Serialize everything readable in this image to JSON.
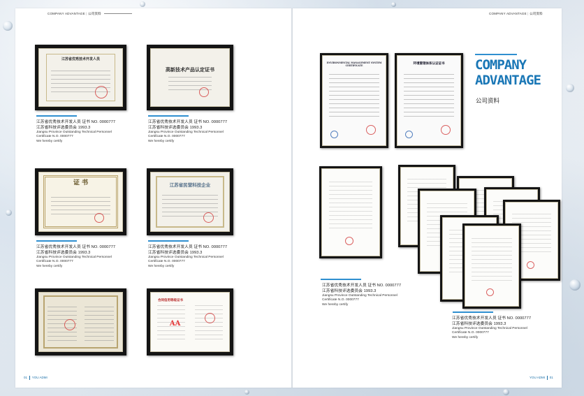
{
  "header": {
    "left_brand": "COMPANY ADVANTAGE",
    "left_section": "公司资料",
    "right_brand": "COMPANY ADVANTAGE",
    "right_section": "公司资料"
  },
  "footer": {
    "left_page": "01",
    "left_brand": "YOU ADMI",
    "right_brand": "YOU ADMI",
    "right_page": "01"
  },
  "title": {
    "line1": "COMPANY",
    "line2": "ADVANTAGE",
    "subtitle": "公司资料"
  },
  "certificates": {
    "c1_title": "江苏省优秀技术开发人员",
    "c2_title": "高新技术产品认定证书",
    "c3_title": "证 书",
    "c4_title": "江苏省民营科技企业",
    "c5_title": "ENVIRONMENTAL MANAGEMENT SYSTEM CERTIFICATE",
    "c6_title": "环境管理体系认证证书",
    "c8_title": "合同信用等级证书",
    "c8_grade": "AA"
  },
  "captions": [
    {
      "cn1": "江苏省优秀技术开发人员    证书 NO. 0000777",
      "cn2": "江苏省科技评选委员会 1993.3",
      "en1": "Jiangsu Province Outstanding Technical Personnel",
      "en2": "Certificate N.O. 0000777",
      "en3": "We hereby certify"
    },
    {
      "cn1": "江苏省优秀技术开发人员    证书 NO. 0000777",
      "cn2": "江苏省科技评选委员会 1993.3",
      "en1": "Jiangsu Province Outstanding Technical Personnel",
      "en2": "Certificate N.O. 0000777",
      "en3": "We hereby certify"
    },
    {
      "cn1": "江苏省优秀技术开发人员    证书 NO. 0000777",
      "cn2": "江苏省科技评选委员会 1993.3",
      "en1": "Jiangsu Province Outstanding Technical Personnel",
      "en2": "Certificate N.O. 0000777",
      "en3": "We hereby certify"
    },
    {
      "cn1": "江苏省优秀技术开发人员    证书 NO. 0000777",
      "cn2": "江苏省科技评选委员会 1993.3",
      "en1": "Jiangsu Province Outstanding Technical Personnel",
      "en2": "Certificate N.O. 0000777",
      "en3": "We hereby certify"
    },
    {
      "cn1": "江苏省优秀技术开发人员    证书 NO. 0000777",
      "cn2": "江苏省科技评选委员会 1993.3",
      "en1": "Jiangsu Province Outstanding Technical Personnel",
      "en2": "Certificate N.O. 0000777",
      "en3": "We hereby certify"
    },
    {
      "cn1": "江苏省优秀技术开发人员    证书 NO. 0000777",
      "cn2": "江苏省科技评选委员会 1993.3",
      "en1": "Jiangsu Province Outstanding Technical Personnel",
      "en2": "Certificate N.O. 0000777",
      "en3": "We hereby certify"
    }
  ],
  "colors": {
    "accent": "#2f8fd0",
    "title_blue": "#1a77b6"
  }
}
